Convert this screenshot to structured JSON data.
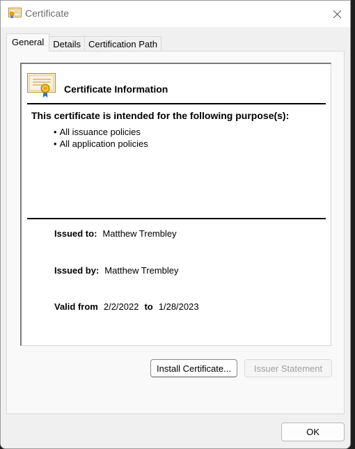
{
  "window": {
    "title": "Certificate",
    "close_label": "✕"
  },
  "tabs": [
    {
      "label": "General",
      "active": true
    },
    {
      "label": "Details",
      "active": false
    },
    {
      "label": "Certification Path",
      "active": false
    }
  ],
  "info": {
    "heading": "Certificate Information",
    "purpose_heading": "This certificate is intended for the following purpose(s):",
    "purposes": [
      "All issuance policies",
      "All application policies"
    ],
    "issued_to_label": "Issued to:",
    "issued_to_value": "Matthew Trembley",
    "issued_by_label": "Issued by:",
    "issued_by_value": "Matthew Trembley",
    "valid_from_label": "Valid from",
    "valid_from_value": "2/2/2022",
    "valid_to_label": "to",
    "valid_to_value": "1/28/2023"
  },
  "buttons": {
    "install": "Install Certificate...",
    "issuer": "Issuer Statement",
    "ok": "OK"
  },
  "icons": {
    "window_icon": "certificate-icon",
    "info_icon": "certificate-icon",
    "close_icon": "close-icon"
  }
}
